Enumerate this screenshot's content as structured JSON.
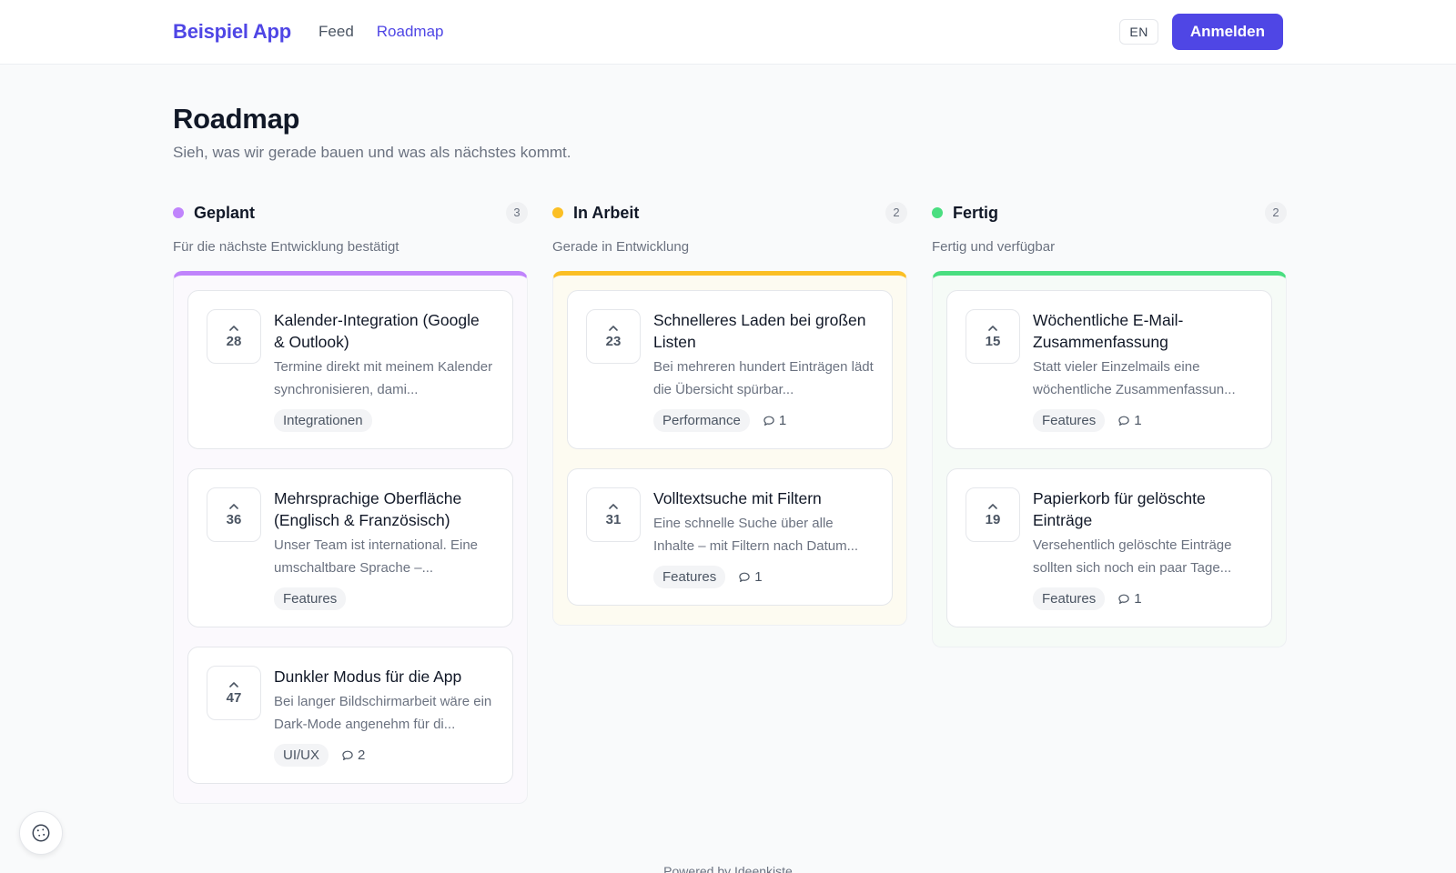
{
  "header": {
    "brand": "Beispiel App",
    "nav": [
      "Feed",
      "Roadmap"
    ],
    "active_nav": "Roadmap",
    "lang_button": "EN",
    "login_button": "Anmelden"
  },
  "page": {
    "title": "Roadmap",
    "subtitle": "Sieh, was wir gerade bauen und was als nächstes kommt."
  },
  "columns": [
    {
      "title": "Geplant",
      "count": "3",
      "description": "Für die nächste Entwicklung bestätigt",
      "color": "#c084fc",
      "cards": [
        {
          "votes": "28",
          "title": "Kalender-Integration (Google & Outlook)",
          "description": "Termine direkt mit meinem Kalender synchronisieren, dami...",
          "tag": "Integrationen",
          "comments": null
        },
        {
          "votes": "36",
          "title": "Mehrsprachige Oberfläche (Englisch & Französisch)",
          "description": "Unser Team ist international. Eine umschaltbare Sprache –...",
          "tag": "Features",
          "comments": null
        },
        {
          "votes": "47",
          "title": "Dunkler Modus für die App",
          "description": "Bei langer Bildschirmarbeit wäre ein Dark-Mode angenehm für di...",
          "tag": "UI/UX",
          "comments": "2"
        }
      ]
    },
    {
      "title": "In Arbeit",
      "count": "2",
      "description": "Gerade in Entwicklung",
      "color": "#fbbf24",
      "cards": [
        {
          "votes": "23",
          "title": "Schnelleres Laden bei großen Listen",
          "description": "Bei mehreren hundert Einträgen lädt die Übersicht spürbar...",
          "tag": "Performance",
          "comments": "1"
        },
        {
          "votes": "31",
          "title": "Volltextsuche mit Filtern",
          "description": "Eine schnelle Suche über alle Inhalte – mit Filtern nach Datum...",
          "tag": "Features",
          "comments": "1"
        }
      ]
    },
    {
      "title": "Fertig",
      "count": "2",
      "description": "Fertig und verfügbar",
      "color": "#4ade80",
      "cards": [
        {
          "votes": "15",
          "title": "Wöchentliche E-Mail-Zusammenfassung",
          "description": "Statt vieler Einzelmails eine wöchentliche Zusammenfassun...",
          "tag": "Features",
          "comments": "1"
        },
        {
          "votes": "19",
          "title": "Papierkorb für gelöschte Einträge",
          "description": "Versehentlich gelöschte Einträge sollten sich noch ein paar Tage...",
          "tag": "Features",
          "comments": "1"
        }
      ]
    }
  ],
  "footer": {
    "text": "Powered by Ideenkiste"
  },
  "icons": {
    "vote": "chevron-up-icon",
    "comments": "comment-icon",
    "cookie": "cookie-icon"
  }
}
